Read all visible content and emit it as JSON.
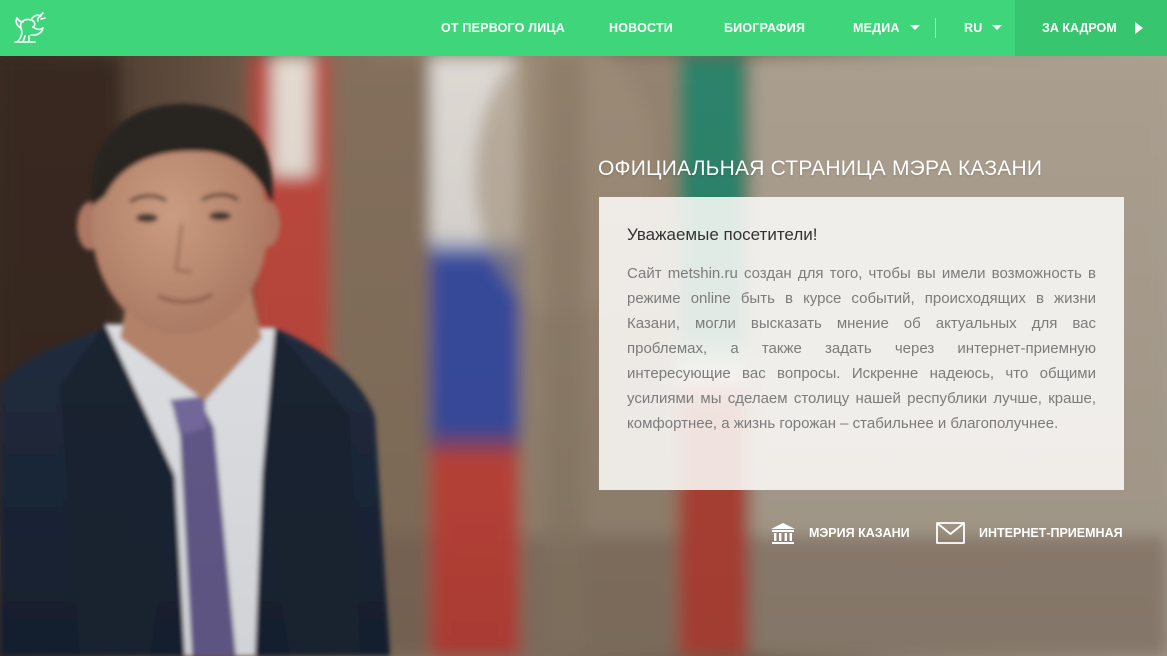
{
  "header": {
    "logo_icon": "kazan-zilant-dragon-icon",
    "nav": [
      {
        "label": "ОТ ПЕРВОГО ЛИЦА"
      },
      {
        "label": "НОВОСТИ"
      },
      {
        "label": "БИОГРАФИЯ"
      },
      {
        "label": "МЕДИА",
        "has_dropdown": true
      },
      {
        "label": "RU",
        "has_dropdown": true
      }
    ],
    "cta": {
      "label": "ЗА КАДРОМ",
      "icon": "play-arrow-icon"
    }
  },
  "hero": {
    "title": "ОФИЦИАЛЬНАЯ СТРАНИЦА МЭРА КАЗАНИ",
    "card": {
      "heading": "Уважаемые посетители!",
      "body": "Сайт metshin.ru создан для того, чтобы вы имели возможность в режиме online быть в курсе событий, происходящих в жизни Казани, могли высказать мнение об актуальных для вас проблемах, а также задать через интернет-приемную интересующие вас вопросы. Искренне надеюсь, что общими усилиями мы сделаем столицу нашей республики лучше, краше, комфортнее, а жизнь горожан – стабильнее и благополучнее."
    },
    "links": [
      {
        "label": "МЭРИЯ КАЗАНИ",
        "icon": "government-building-icon"
      },
      {
        "label": "ИНТЕРНЕТ-ПРИЕМНАЯ",
        "icon": "envelope-icon"
      }
    ]
  },
  "colors": {
    "nav_bg": "#3fd57a",
    "cta_bg": "#37c56f",
    "text_light": "#ffffff",
    "card_text": "#7c7c7c"
  }
}
